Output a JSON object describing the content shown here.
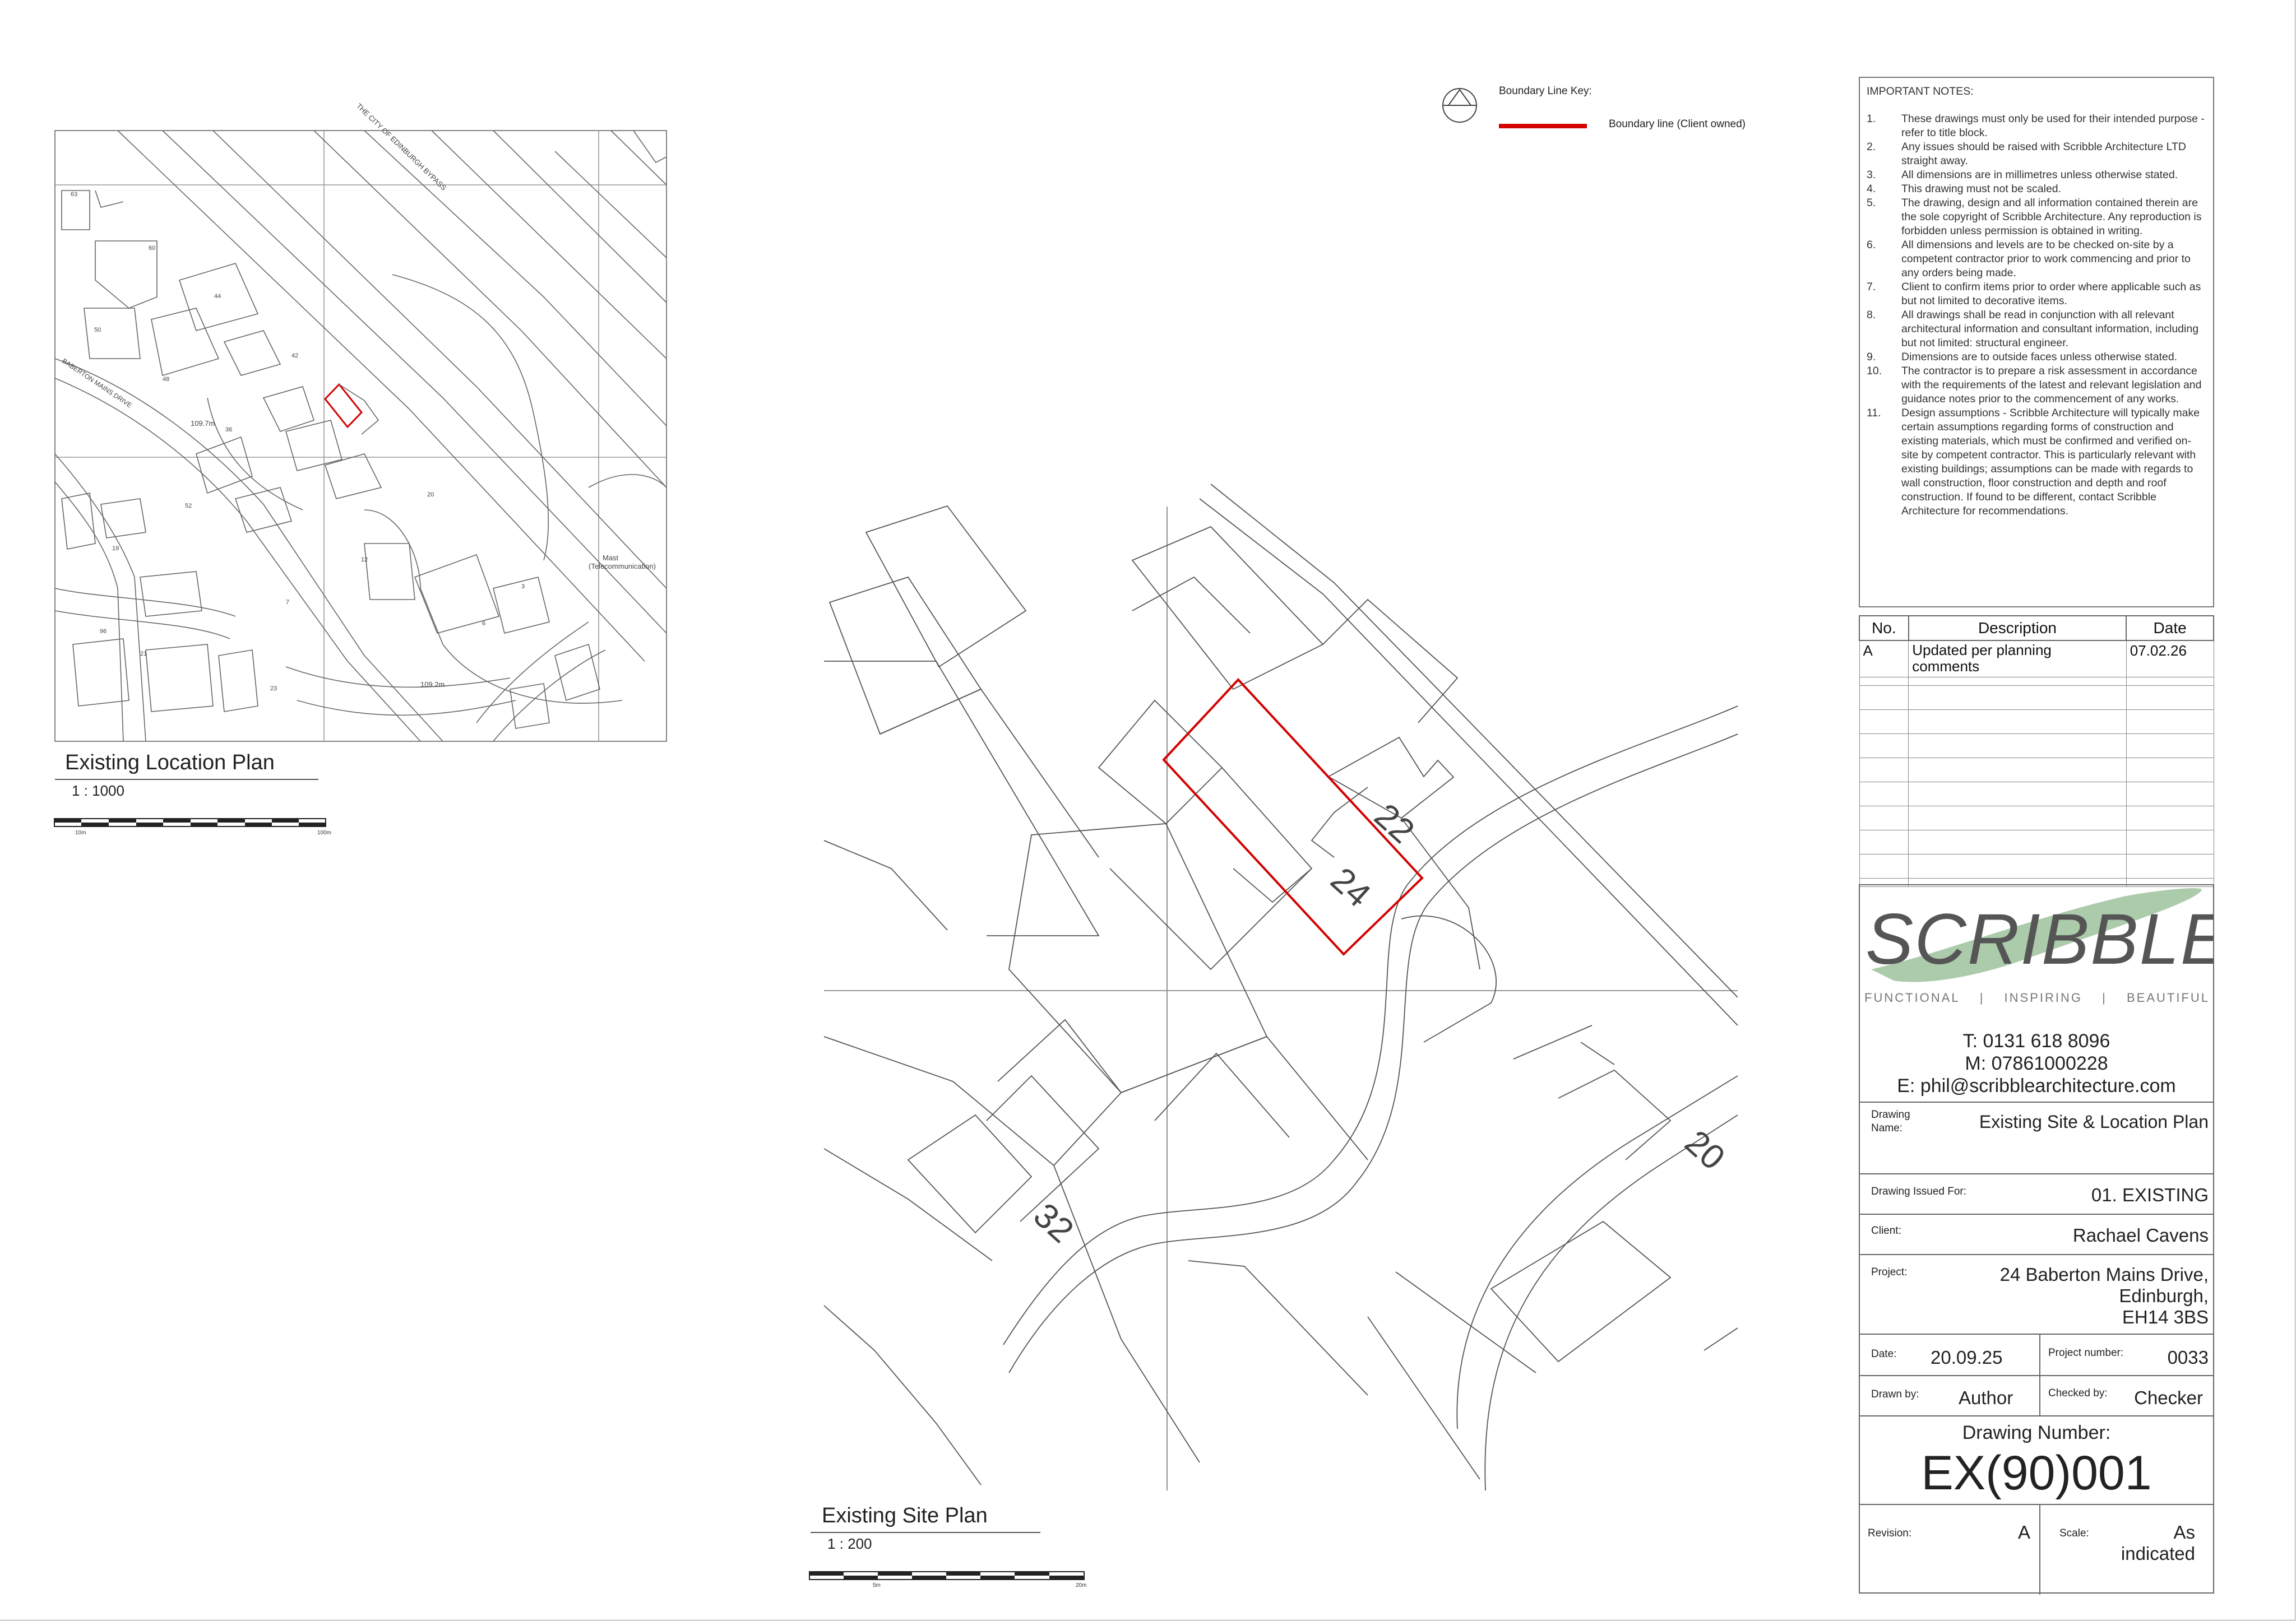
{
  "key": {
    "title": "Boundary Line Key:",
    "item": "Boundary line (Client owned)",
    "boundary_color": "#d40000"
  },
  "location_plan": {
    "title": "Existing Location Plan",
    "scale": "1 : 1000",
    "bar_start": "10m",
    "bar_end": "100m",
    "labels": {
      "bypass": "THE CITY OF EDINBURGH BYPASS",
      "drive": "BABERTON MAINS DRIVE",
      "mast": "Mast",
      "mast_sub": "(Telecommunication)",
      "level1": "109.7m",
      "level2": "109.2m",
      "n63": "63",
      "n60": "60",
      "n44": "44",
      "n50": "50",
      "n48": "48",
      "n42": "42",
      "n36": "36",
      "n20": "20",
      "n19": "19",
      "n52": "52",
      "n12": "12",
      "n7": "7",
      "n96": "96",
      "n23": "23",
      "n21": "21",
      "n6": "6",
      "n3": "3"
    }
  },
  "site_plan": {
    "title": "Existing Site Plan",
    "scale": "1 : 200",
    "bar_start": "5m",
    "bar_end": "20m",
    "plots": {
      "p22": "22",
      "p24": "24",
      "p32": "32",
      "p20": "20"
    }
  },
  "notes": {
    "header": "IMPORTANT NOTES:",
    "items": [
      {
        "n": "1.",
        "t": "These drawings must only be used for their intended purpose - refer to title block."
      },
      {
        "n": "2.",
        "t": "Any issues should be raised with Scribble Architecture LTD straight away."
      },
      {
        "n": "3.",
        "t": "All dimensions are in millimetres unless otherwise stated."
      },
      {
        "n": "4.",
        "t": "This drawing must not be scaled."
      },
      {
        "n": "5.",
        "t": "The drawing, design and all information contained therein are the sole copyright of Scribble Architecture. Any reproduction is forbidden unless permission is obtained in writing."
      },
      {
        "n": "6.",
        "t": "All dimensions and levels are to be checked on-site by a competent contractor prior to work commencing and prior to any orders being made."
      },
      {
        "n": "7.",
        "t": "Client to confirm items prior to order where applicable such as but not limited to decorative items."
      },
      {
        "n": "8.",
        "t": "All drawings shall be read in conjunction with all relevant architectural information and consultant information, including but not limited: structural engineer."
      },
      {
        "n": "9.",
        "t": "Dimensions are to outside faces unless otherwise stated."
      },
      {
        "n": "10.",
        "t": "The contractor is to prepare a risk assessment in accordance with the requirements of the latest and relevant legislation and guidance notes prior to the commencement of any works."
      },
      {
        "n": "11.",
        "t": "Design assumptions - Scribble Architecture will typically make certain assumptions regarding forms of construction and existing materials, which must be confirmed and verified on-site by competent contractor. This is particularly relevant with existing buildings; assumptions can be made with regards to wall construction, floor construction and depth and roof construction. If found to be different, contact Scribble Architecture for recommendations."
      }
    ]
  },
  "revisions": {
    "headers": {
      "no": "No.",
      "description": "Description",
      "date": "Date"
    },
    "rows": [
      {
        "no": "A",
        "description": "Updated per planning comments",
        "date": "07.02.26"
      }
    ]
  },
  "title_block": {
    "logo_text": "SCRIBBLE",
    "tagline": [
      "FUNCTIONAL",
      "|",
      "INSPIRING",
      "|",
      "BEAUTIFUL"
    ],
    "logo_color": "#555555",
    "swoosh_color": "#8fb98f",
    "phone": "T: 0131 618 8096",
    "mobile": "M: 07861000228",
    "email": "E: phil@scribblearchitecture.com",
    "drawing_name_label": "Drawing Name:",
    "drawing_name": "Existing Site & Location Plan",
    "issued_for_label": "Drawing Issued For:",
    "issued_for": "01. EXISTING",
    "client_label": "Client:",
    "client": "Rachael Cavens",
    "project_label": "Project:",
    "project_line1": "24 Baberton Mains Drive,",
    "project_line2": "Edinburgh,",
    "project_line3": "EH14 3BS",
    "date_label": "Date:",
    "date": "20.09.25",
    "project_number_label": "Project number:",
    "project_number": "0033",
    "drawn_by_label": "Drawn by:",
    "drawn_by": "Author",
    "checked_by_label": "Checked by:",
    "checked_by": "Checker",
    "drawing_number_label": "Drawing Number:",
    "drawing_number": "EX(90)001",
    "revision_label": "Revision:",
    "revision": "A",
    "scale_label": "Scale:",
    "scale_line1": "As",
    "scale_line2": "indicated"
  }
}
